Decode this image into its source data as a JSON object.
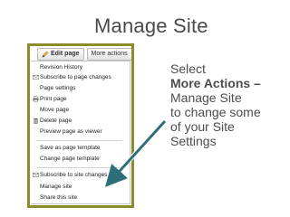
{
  "slide": {
    "title": "Manage Site"
  },
  "toolbar": {
    "edit_label": "Edit page",
    "more_label": "More actions",
    "more_caret": "▼"
  },
  "menu": {
    "items": [
      {
        "label": "Revision History"
      },
      {
        "label": "Subscribe to page changes"
      },
      {
        "label": "Page settings"
      },
      {
        "label": "Print page"
      },
      {
        "label": "Move page"
      },
      {
        "label": "Delete page"
      },
      {
        "label": "Preview page as viewer"
      },
      {
        "label": "Save as page template"
      },
      {
        "label": "Change page template"
      },
      {
        "label": "Subscribe to site changes"
      },
      {
        "label": "Manage site"
      },
      {
        "label": "Share this site"
      }
    ]
  },
  "instruction": {
    "line1": "Select",
    "line2": "More Actions –",
    "line3": "Manage Site",
    "line4": "to change some",
    "line5": "of your Site",
    "line6": "Settings"
  },
  "colors": {
    "frame": "#8b8b2a",
    "arrow": "#2e6e7a"
  }
}
